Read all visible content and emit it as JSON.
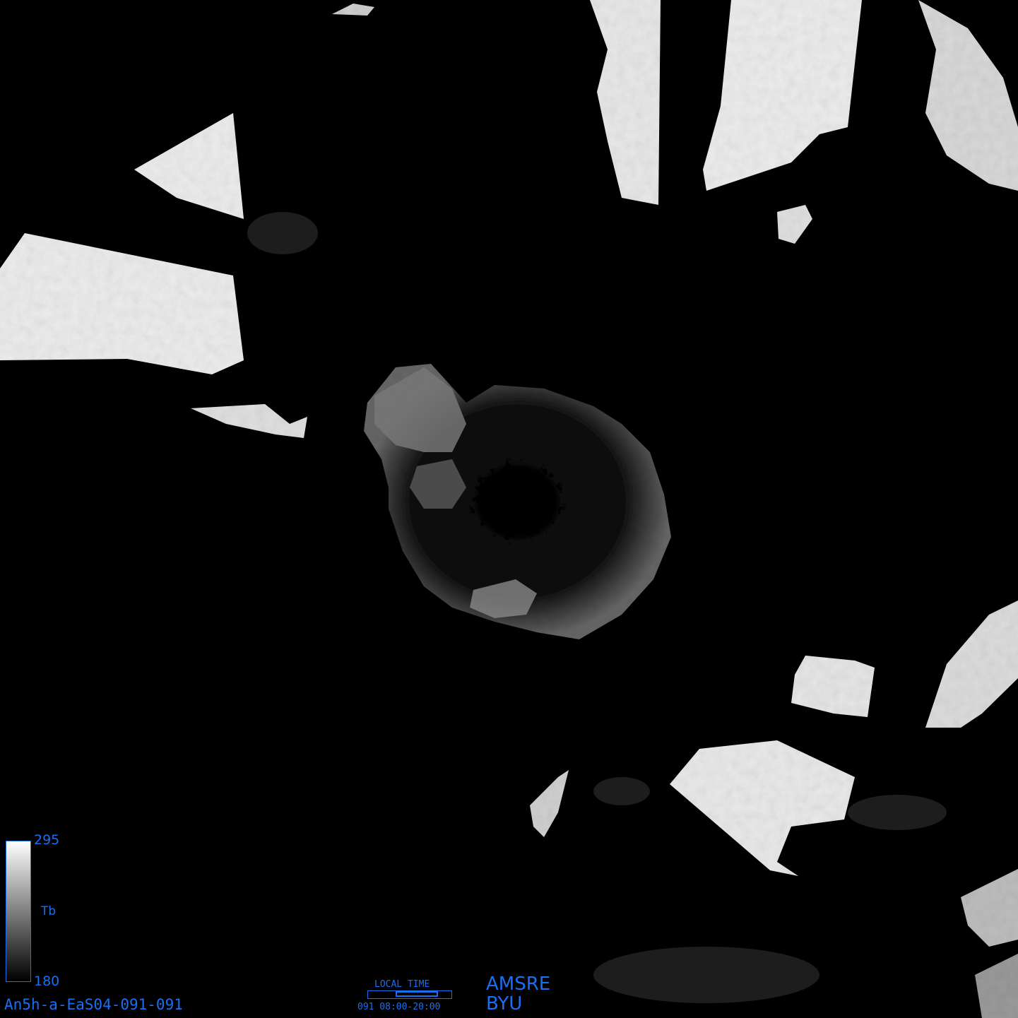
{
  "map": {
    "projection": "polar-stereographic-south",
    "background_color": "#000000",
    "land_color_hot": "#f2f2f2",
    "ice_color": "#555555"
  },
  "colorbar": {
    "max_label": "295",
    "min_label": "180",
    "unit_label": "Tb",
    "accent_color": "#1a6ff0"
  },
  "footer": {
    "image_id": "An5h-a-EaS04-091-091",
    "local_time": {
      "title": "LOCAL TIME",
      "range_label": "091  08:00-20:00",
      "start_fraction": 0.333,
      "end_fraction": 0.833
    },
    "sensor": "AMSRE",
    "organization": "BYU"
  }
}
